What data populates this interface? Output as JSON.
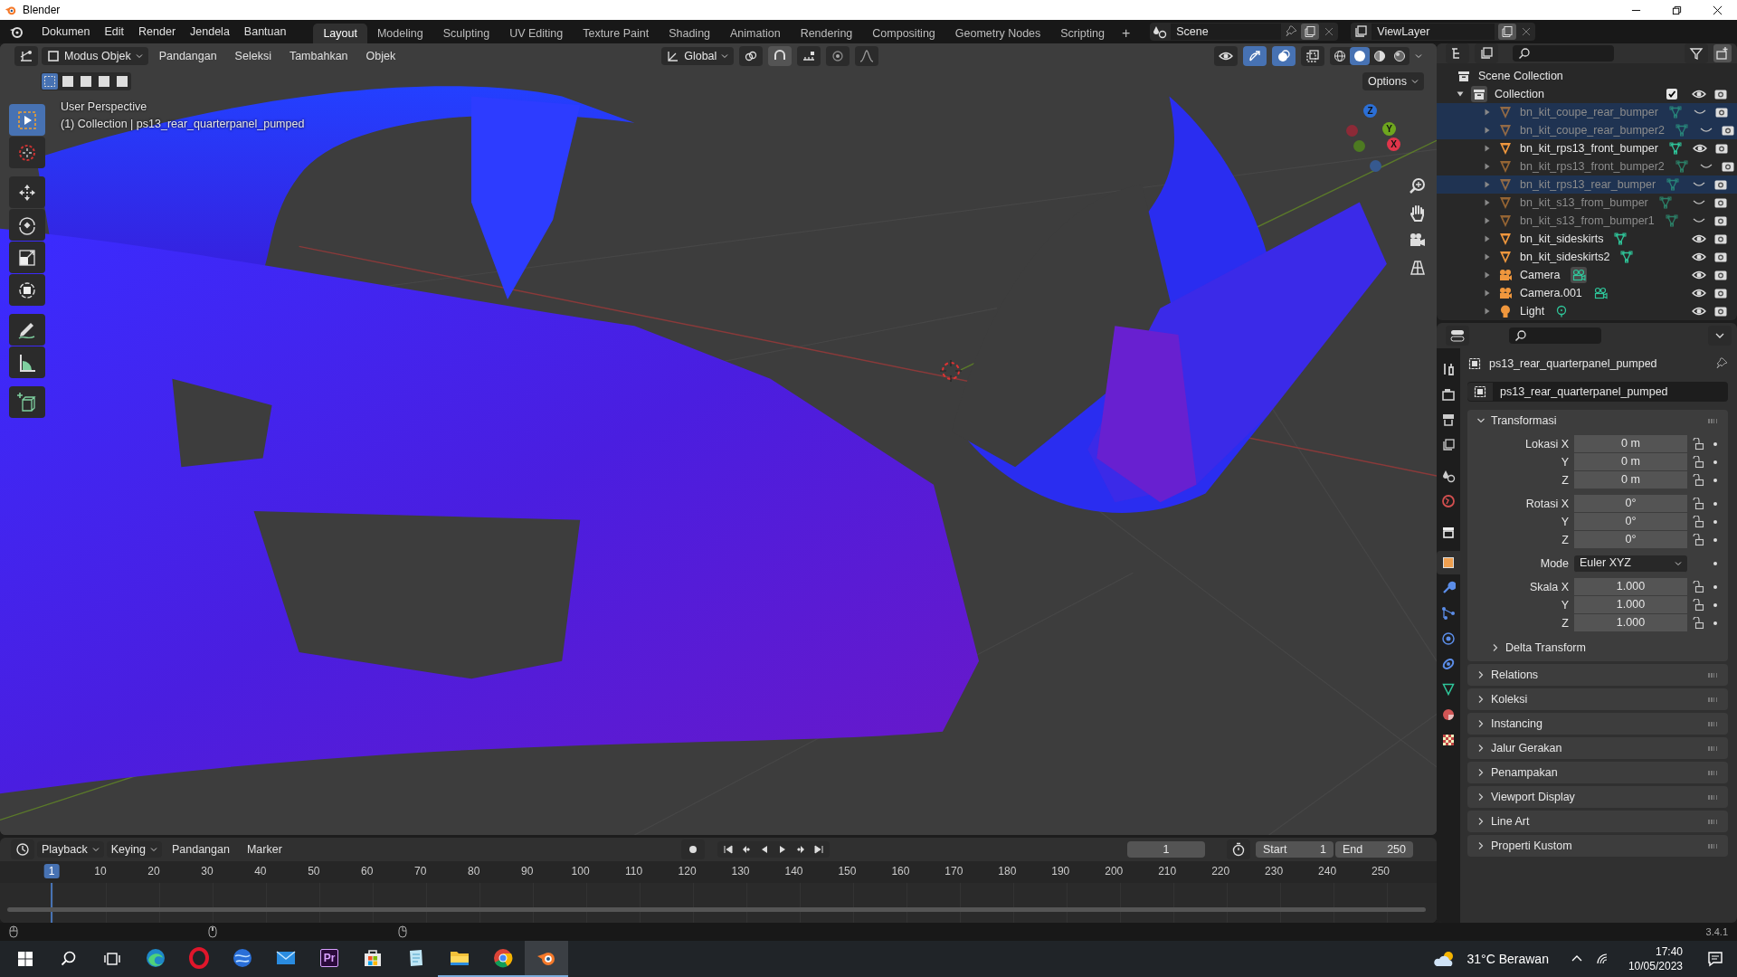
{
  "window": {
    "title": "Blender"
  },
  "menus": [
    "Dokumen",
    "Edit",
    "Render",
    "Jendela",
    "Bantuan"
  ],
  "workspaces": [
    {
      "label": "Layout",
      "selected": true
    },
    {
      "label": "Modeling",
      "selected": false
    },
    {
      "label": "Sculpting",
      "selected": false
    },
    {
      "label": "UV Editing",
      "selected": false
    },
    {
      "label": "Texture Paint",
      "selected": false
    },
    {
      "label": "Shading",
      "selected": false
    },
    {
      "label": "Animation",
      "selected": false
    },
    {
      "label": "Rendering",
      "selected": false
    },
    {
      "label": "Compositing",
      "selected": false
    },
    {
      "label": "Geometry Nodes",
      "selected": false
    },
    {
      "label": "Scripting",
      "selected": false
    }
  ],
  "add_workspace": "+",
  "scene": {
    "name": "Scene"
  },
  "view_layer": {
    "name": "ViewLayer"
  },
  "viewport": {
    "mode": "Modus Objek",
    "menus": [
      "Pandangan",
      "Seleksi",
      "Tambahkan",
      "Objek"
    ],
    "orientation": "Global",
    "options": "Options",
    "info": [
      "User Perspective",
      "(1) Collection | ps13_rear_quarterpanel_pumped"
    ],
    "axes": [
      {
        "label": "Z",
        "color": "#2b6fd6"
      },
      {
        "label": "Y",
        "color": "#6ea61e"
      },
      {
        "label": "X",
        "color": "#e0354a"
      }
    ],
    "select_modes": [
      {
        "selected": true
      },
      {
        "selected": false
      },
      {
        "selected": false
      },
      {
        "selected": false
      },
      {
        "selected": false
      }
    ],
    "tools": [
      {
        "kind": "select",
        "selected": true
      },
      {
        "kind": "cursor",
        "selected": false
      },
      {
        "kind": "move",
        "selected": false
      },
      {
        "kind": "rotate",
        "selected": false
      },
      {
        "kind": "scale",
        "selected": false
      },
      {
        "kind": "transform",
        "selected": false
      },
      {
        "kind": "annotate",
        "selected": false
      },
      {
        "kind": "measure",
        "selected": false
      },
      {
        "kind": "add_cube",
        "selected": false
      }
    ],
    "shading": [
      {
        "kind": "wireframe",
        "selected": false
      },
      {
        "kind": "solid",
        "selected": true
      },
      {
        "kind": "material",
        "selected": false
      },
      {
        "kind": "rendered",
        "selected": false
      }
    ]
  },
  "outliner": {
    "root": "Scene Collection",
    "collection": {
      "name": "Collection",
      "checked": true,
      "expanded": true,
      "children": [
        {
          "name": "bn_kit_coupe_rear_bumper",
          "kind": "mesh",
          "hidden": true,
          "selected": true
        },
        {
          "name": "bn_kit_coupe_rear_bumper2",
          "kind": "mesh",
          "hidden": true,
          "selected": true
        },
        {
          "name": "bn_kit_rps13_front_bumper",
          "kind": "mesh",
          "hidden": false,
          "selected": false
        },
        {
          "name": "bn_kit_rps13_front_bumper2",
          "kind": "mesh",
          "hidden": true,
          "selected": false
        },
        {
          "name": "bn_kit_rps13_rear_bumper",
          "kind": "mesh",
          "hidden": true,
          "selected": true
        },
        {
          "name": "bn_kit_s13_from_bumper",
          "kind": "mesh",
          "hidden": true,
          "selected": false
        },
        {
          "name": "bn_kit_s13_from_bumper1",
          "kind": "mesh",
          "hidden": true,
          "selected": false
        },
        {
          "name": "bn_kit_sideskirts",
          "kind": "mesh",
          "hidden": false,
          "selected": false
        },
        {
          "name": "bn_kit_sideskirts2",
          "kind": "mesh",
          "hidden": false,
          "selected": false
        },
        {
          "name": "Camera",
          "kind": "camera",
          "hidden": false,
          "selected": false
        },
        {
          "name": "Camera.001",
          "kind": "camera",
          "hidden": false,
          "selected": false
        },
        {
          "name": "Light",
          "kind": "light",
          "hidden": false,
          "selected": false
        }
      ]
    }
  },
  "properties": {
    "object": "ps13_rear_quarterpanel_pumped",
    "data_name": "ps13_rear_quarterpanel_pumped",
    "tabs": [
      {
        "kind": "tool",
        "selected": false
      },
      {
        "kind": "render",
        "selected": false
      },
      {
        "kind": "output",
        "selected": false
      },
      {
        "kind": "view_layer",
        "selected": false
      },
      {
        "kind": "scene",
        "selected": false
      },
      {
        "kind": "world",
        "selected": false
      },
      {
        "kind": "collection",
        "selected": false
      },
      {
        "kind": "object",
        "selected": true
      },
      {
        "kind": "modifiers",
        "selected": false
      },
      {
        "kind": "particles",
        "selected": false
      },
      {
        "kind": "physics",
        "selected": false
      },
      {
        "kind": "constraints",
        "selected": false
      },
      {
        "kind": "data",
        "selected": false
      },
      {
        "kind": "material",
        "selected": false
      },
      {
        "kind": "texture",
        "selected": false
      }
    ],
    "transform": {
      "title": "Transformasi",
      "expanded": true,
      "rows": [
        {
          "kind": "vector",
          "fields": [
            {
              "label": "Lokasi X",
              "value": "0 m"
            },
            {
              "label": "Y",
              "value": "0 m"
            },
            {
              "label": "Z",
              "value": "0 m"
            }
          ]
        },
        {
          "kind": "vector",
          "fields": [
            {
              "label": "Rotasi X",
              "value": "0°"
            },
            {
              "label": "Y",
              "value": "0°"
            },
            {
              "label": "Z",
              "value": "0°"
            }
          ]
        },
        {
          "kind": "dropdown",
          "label": "Mode",
          "value": "Euler XYZ"
        },
        {
          "kind": "vector",
          "fields": [
            {
              "label": "Skala X",
              "value": "1.000"
            },
            {
              "label": "Y",
              "value": "1.000"
            },
            {
              "label": "Z",
              "value": "1.000"
            }
          ]
        }
      ],
      "subpanel": "Delta Transform"
    },
    "panels": [
      "Relations",
      "Koleksi",
      "Instancing",
      "Jalur Gerakan",
      "Penampakan",
      "Viewport Display",
      "Line Art",
      "Properti Kustom"
    ]
  },
  "timeline": {
    "menus": [
      "Playback",
      "Keying",
      "Pandangan",
      "Marker"
    ],
    "current_frame": "1",
    "start_label": "Start",
    "start": "1",
    "end_label": "End",
    "end": "250",
    "ruler": [
      {
        "label": "1",
        "selected": true
      },
      {
        "label": "10",
        "selected": false
      },
      {
        "label": "20",
        "selected": false
      },
      {
        "label": "30",
        "selected": false
      },
      {
        "label": "40",
        "selected": false
      },
      {
        "label": "50",
        "selected": false
      },
      {
        "label": "60",
        "selected": false
      },
      {
        "label": "70",
        "selected": false
      },
      {
        "label": "80",
        "selected": false
      },
      {
        "label": "90",
        "selected": false
      },
      {
        "label": "100",
        "selected": false
      },
      {
        "label": "110",
        "selected": false
      },
      {
        "label": "120",
        "selected": false
      },
      {
        "label": "130",
        "selected": false
      },
      {
        "label": "140",
        "selected": false
      },
      {
        "label": "150",
        "selected": false
      },
      {
        "label": "160",
        "selected": false
      },
      {
        "label": "170",
        "selected": false
      },
      {
        "label": "180",
        "selected": false
      },
      {
        "label": "190",
        "selected": false
      },
      {
        "label": "200",
        "selected": false
      },
      {
        "label": "210",
        "selected": false
      },
      {
        "label": "220",
        "selected": false
      },
      {
        "label": "230",
        "selected": false
      },
      {
        "label": "240",
        "selected": false
      },
      {
        "label": "250",
        "selected": false
      }
    ]
  },
  "status_bar": {
    "version": "3.4.1"
  },
  "taskbar": {
    "apps": [
      {
        "kind": "edge",
        "running": false,
        "selected": false
      },
      {
        "kind": "opera",
        "running": false,
        "selected": false
      },
      {
        "kind": "globe",
        "running": false,
        "selected": false
      },
      {
        "kind": "mail",
        "running": false,
        "selected": false
      },
      {
        "kind": "premiere",
        "label": "Pr",
        "running": false,
        "selected": false
      },
      {
        "kind": "store",
        "running": false,
        "selected": false
      },
      {
        "kind": "notepad",
        "running": false,
        "selected": false
      },
      {
        "kind": "explorer",
        "running": true,
        "selected": false
      },
      {
        "kind": "chrome",
        "running": true,
        "selected": false
      },
      {
        "kind": "blender",
        "running": true,
        "selected": true
      }
    ],
    "weather": "31°C Berawan",
    "time": "17:40",
    "date": "10/05/2023"
  }
}
